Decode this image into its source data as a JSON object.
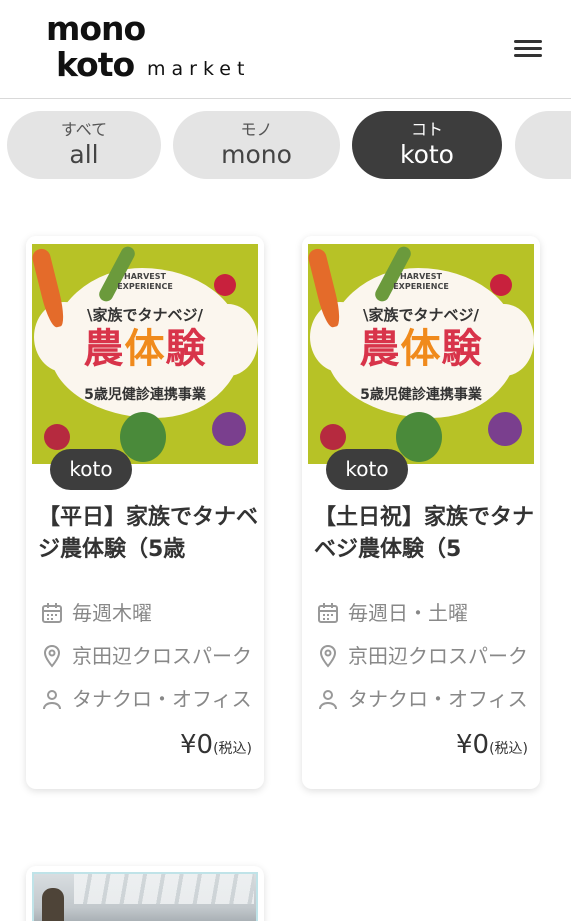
{
  "header": {
    "logo_line1": "mono",
    "logo_line2": "koto",
    "logo_market": "market",
    "menu_icon": "hamburger-menu-icon"
  },
  "tabs": [
    {
      "ja": "すべて",
      "en": "all",
      "active": false
    },
    {
      "ja": "モノ",
      "en": "mono",
      "active": false
    },
    {
      "ja": "コト",
      "en": "koto",
      "active": true
    }
  ],
  "cards": [
    {
      "poster": {
        "harvest": "HARVEST",
        "experience": "EXPERIENCE",
        "subtitle": "\\家族でタナベジ/",
        "main_1": "農",
        "main_2": "体",
        "main_3": "験",
        "note": "5歳児健診連携事業"
      },
      "badge": "koto",
      "title": "【平日】家族でタナベジ農体験（5歳",
      "date": "毎週木曜",
      "place": "京田辺クロスパーク",
      "org": "タナクロ・オフィス",
      "price": "¥0",
      "tax": "(税込)"
    },
    {
      "poster": {
        "harvest": "HARVEST",
        "experience": "EXPERIENCE",
        "subtitle": "\\家族でタナベジ/",
        "main_1": "農",
        "main_2": "体",
        "main_3": "験",
        "note": "5歳児健診連携事業"
      },
      "badge": "koto",
      "title": "【土日祝】家族でタナベジ農体験（5",
      "date": "毎週日・土曜",
      "place": "京田辺クロスパーク",
      "org": "タナクロ・オフィス",
      "price": "¥0",
      "tax": "(税込)"
    }
  ],
  "icons": {
    "date": "calendar-icon",
    "place": "location-pin-icon",
    "org": "person-icon"
  },
  "colors": {
    "active_tab": "#3d3d3d",
    "inactive_tab": "#e4e4e4",
    "badge": "#3d3d3d",
    "poster_bg": "#b7c226",
    "poster_title": "#d8344a",
    "poster_title_accent": "#f08a1c"
  }
}
